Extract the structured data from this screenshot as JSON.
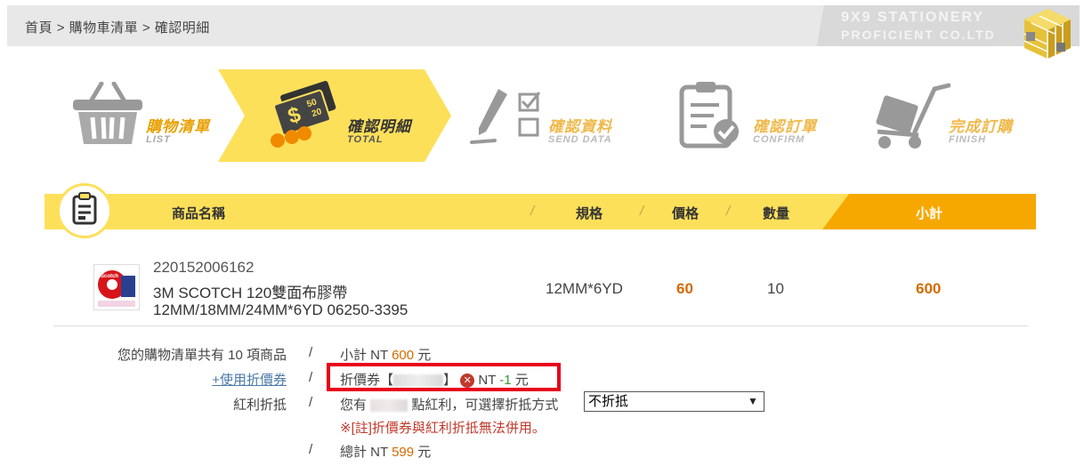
{
  "breadcrumb": {
    "home": "首頁",
    "sep1": ">",
    "cart": "購物車清單",
    "sep2": ">",
    "current": "確認明細"
  },
  "brand": {
    "line1": "9X9 STATIONERY",
    "line2": "PROFICIENT CO.LTD"
  },
  "steps": [
    {
      "ch": "購物清單",
      "en": "LIST",
      "state": "done"
    },
    {
      "ch": "確認明細",
      "en": "TOTAL",
      "state": "active"
    },
    {
      "ch": "確認資料",
      "en": "SEND DATA",
      "state": "pending"
    },
    {
      "ch": "確認訂單",
      "en": "CONFIRM",
      "state": "pending"
    },
    {
      "ch": "完成訂購",
      "en": "FINISH",
      "state": "pending"
    }
  ],
  "table_header": {
    "name": "商品名稱",
    "spec": "規格",
    "price": "價格",
    "qty": "數量",
    "subtotal": "小計",
    "sep": "/"
  },
  "item": {
    "code": "220152006162",
    "name1": "3M SCOTCH 120雙面布膠帶",
    "name2": "12MM/18MM/24MM*6YD 06250-3395",
    "spec": "12MM*6YD",
    "price": "60",
    "qty": "10",
    "subtotal": "600",
    "thumb_text": "Scotch"
  },
  "summary": {
    "count_label": "您的購物清單共有 10 項商品",
    "slash": "/",
    "subtotal_prefix": "小計 NT ",
    "subtotal_value": "600",
    "subtotal_suffix": " 元",
    "coupon_link": "+使用折價券",
    "coupon_prefix": "折價券【",
    "coupon_mid": "】",
    "coupon_nt": " NT ",
    "coupon_value": "-1",
    "coupon_suffix": " 元",
    "bonus_label": "紅利折抵",
    "bonus_prefix": "您有 ",
    "bonus_mid": " 點紅利，可選擇折抵方式",
    "bonus_select": "不折抵",
    "note": "※[註]折價券與紅利折抵無法併用。",
    "total_prefix": "總計 NT ",
    "total_value": "599",
    "total_suffix": " 元"
  },
  "colors": {
    "accent_yellow": "#fde05a",
    "accent_orange": "#f7a800",
    "price_orange": "#d46a00",
    "highlight_red": "#e8001c"
  }
}
